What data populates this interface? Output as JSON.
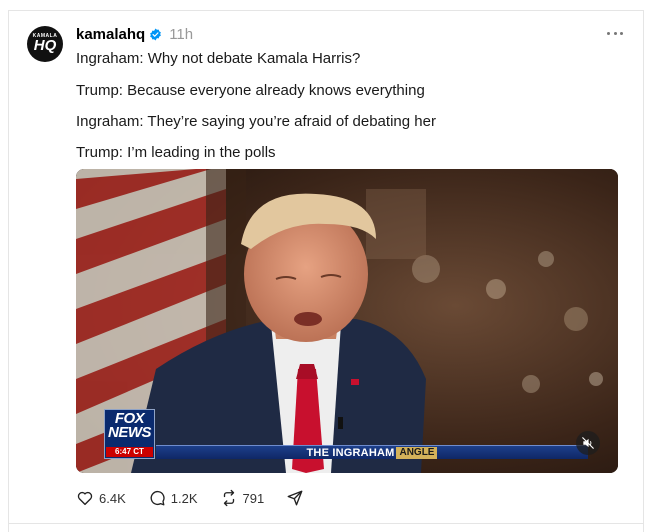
{
  "post": {
    "username": "kamalahq",
    "time": "11h",
    "avatar": {
      "top": "KAMALA",
      "main": "HQ"
    },
    "lines": [
      "Ingraham: Why not debate Kamala Harris?",
      "Trump: Because everyone already knows everything",
      "Ingraham: They’re saying you’re afraid of debating her",
      "Trump: I’m leading in the polls"
    ],
    "video": {
      "network": "FOX",
      "network_sub": "NEWS",
      "clock": "6:47 CT",
      "show_name": "THE INGRAHAM",
      "show_angle": "ANGLE"
    },
    "actions": {
      "likes": "6.4K",
      "replies": "1.2K",
      "reposts": "791"
    },
    "icons": [
      "verified-badge-icon",
      "more-options-icon",
      "heart-icon",
      "comment-icon",
      "repost-icon",
      "share-icon",
      "mute-icon"
    ],
    "colors": {
      "verified": "#0095f6",
      "fox_blue": "#0a2a6e",
      "fox_red": "#cc0000"
    }
  }
}
